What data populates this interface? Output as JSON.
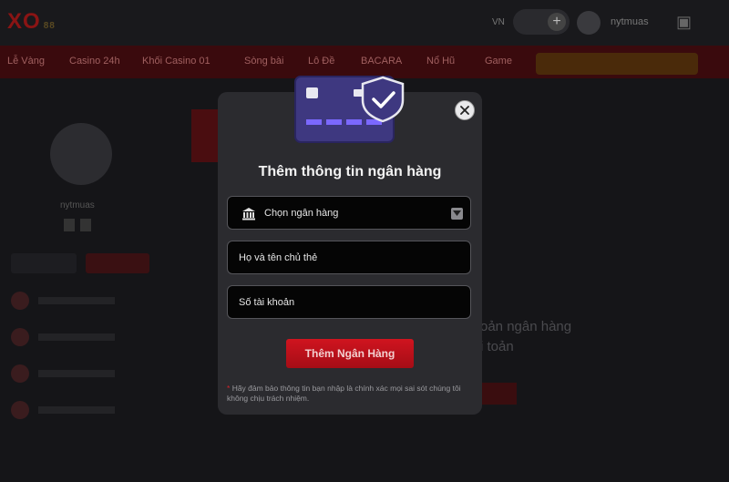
{
  "background": {
    "logo": "XO",
    "logo_sub": "88",
    "language": "VN",
    "username": "nytmuas",
    "nav_items": [
      "Lễ Vàng",
      "Casino 24h",
      "Khối Casino 01",
      "Sòng bài",
      "Lô Đề",
      "BACARA",
      "Nổ Hũ",
      "Game"
    ],
    "profile_name": "nytmuas",
    "text_line1": "oản ngân hàng",
    "text_line2": "i toản"
  },
  "modal": {
    "title": "Thêm thông tin ngân hàng",
    "bank_select": {
      "selected": "Chọn ngân hàng"
    },
    "holder_field": {
      "placeholder": "Họ và tên chủ thẻ"
    },
    "account_field": {
      "placeholder": "Số tài khoản"
    },
    "submit_label": "Thêm Ngân Hàng",
    "note_star": "*",
    "note_text": "Hãy đảm bảo thông tin bạn nhập là chính xác mọi sai sót chúng tôi không chịu trách nhiệm."
  },
  "icons": {
    "close": "close-icon",
    "bank": "bank-icon",
    "dropdown": "chevron-down-icon",
    "card": "credit-card-shield-icon"
  },
  "colors": {
    "accent": "#d0141f",
    "modal_bg": "#2b2b2f",
    "field_bg": "#050505",
    "card_purple": "#3e3880",
    "card_stripe": "#7b68ff"
  }
}
